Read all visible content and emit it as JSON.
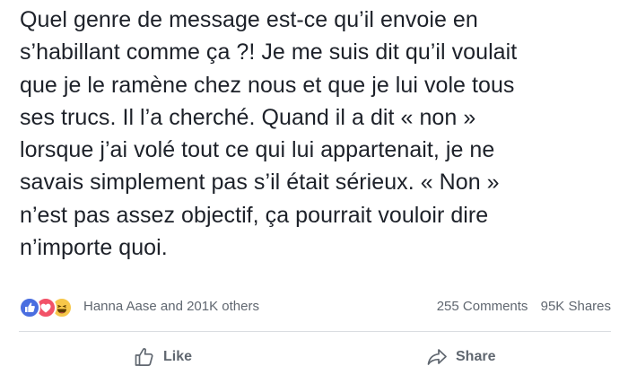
{
  "post": {
    "text": "Quel genre de message est-ce qu’il envoie en\ns’habillant comme ça ?! Je me suis dit qu’il voulait\nque je le ramène chez nous et que je lui vole tous\nses trucs. Il l’a cherché. Quand il a dit « non »\nlorsque j’ai volé tout ce qui lui appartenait, je ne\nsavais simplement pas s’il était sérieux. « Non »\nn’est pas assez objectif, ça pourrait vouloir dire\nn’importe quoi."
  },
  "reactions": {
    "icons": [
      "like-icon",
      "love-icon",
      "haha-icon"
    ],
    "summary": "Hanna Aase and 201K others",
    "comments": "255 Comments",
    "shares": "95K Shares"
  },
  "actions": {
    "like_label": "Like",
    "like_icon": "thumbs-up-icon",
    "share_label": "Share",
    "share_icon": "share-arrow-icon"
  },
  "colors": {
    "text": "#1d2129",
    "muted": "#606770",
    "like": "#4a6ee0",
    "love": "#f25268",
    "haha": "#f7c74a"
  }
}
